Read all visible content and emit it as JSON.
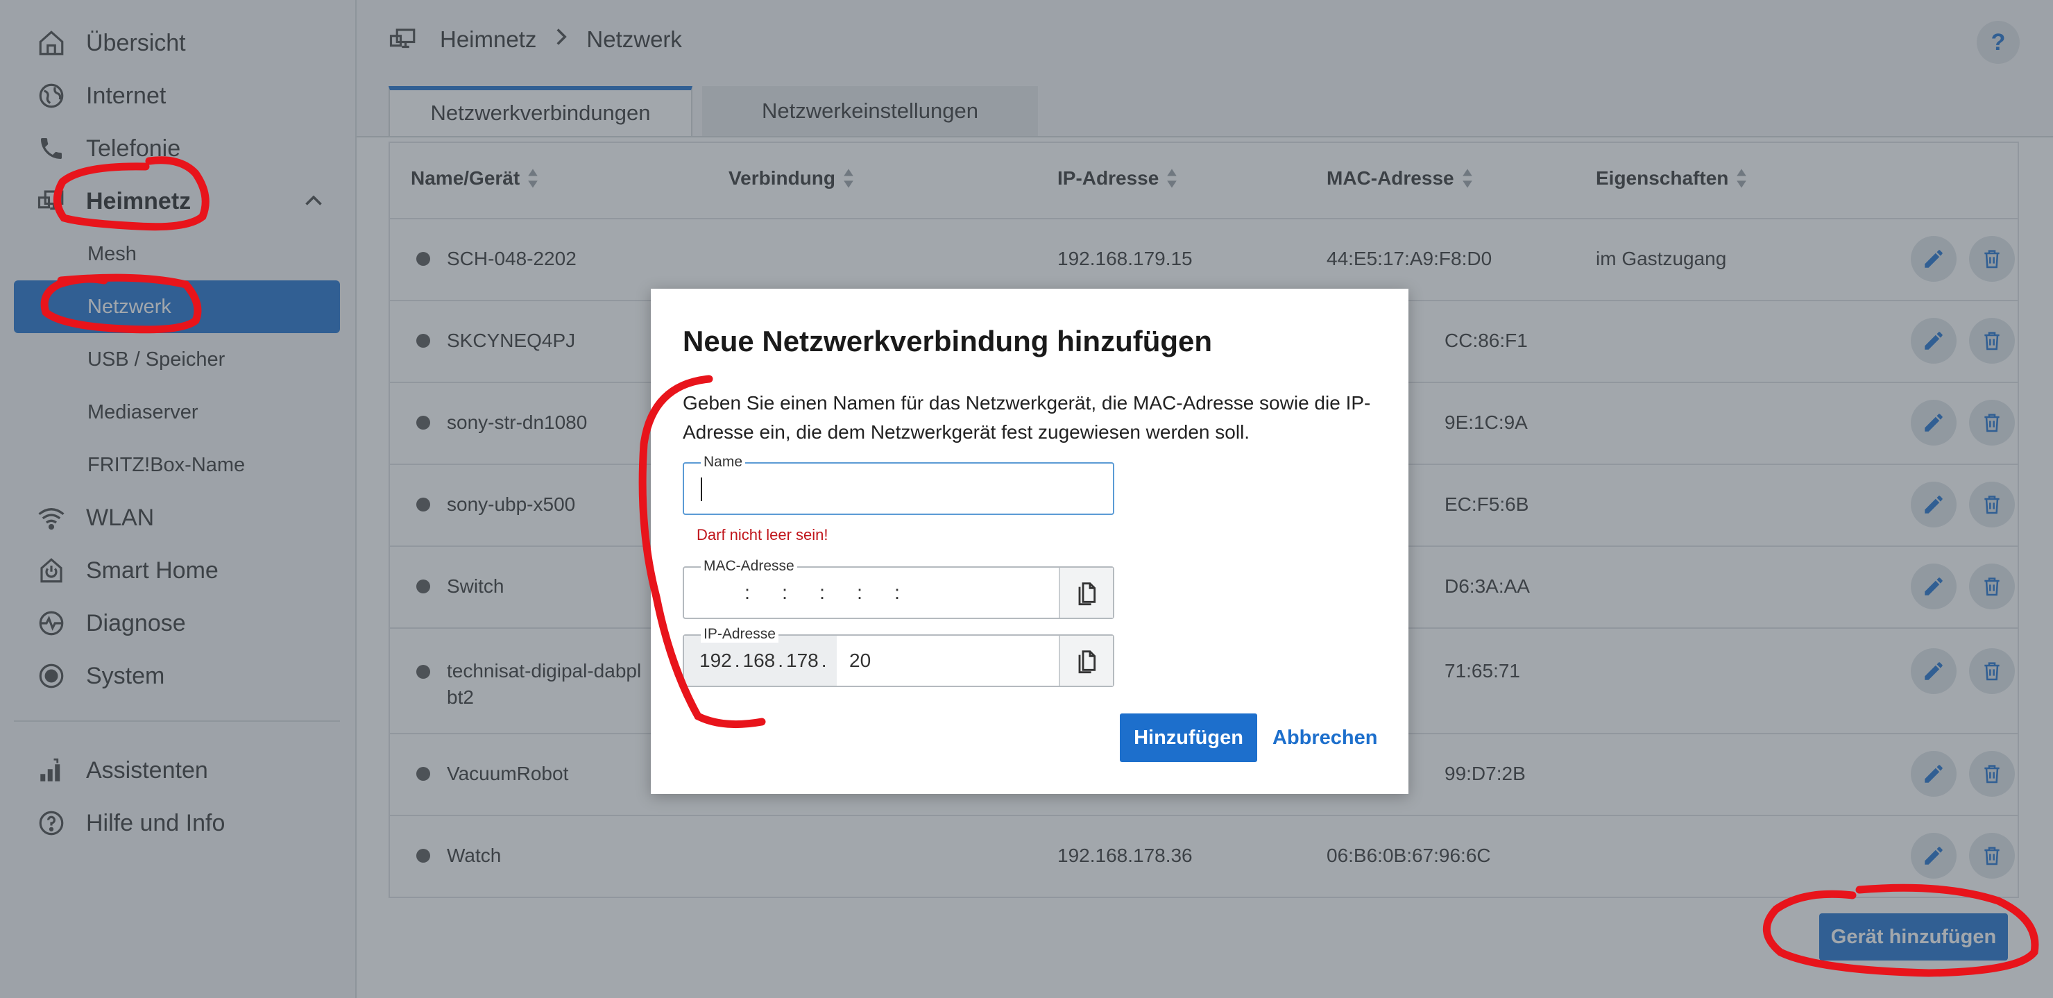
{
  "sidebar": {
    "items": [
      {
        "label": "Übersicht",
        "icon": "home-icon"
      },
      {
        "label": "Internet",
        "icon": "globe-icon"
      },
      {
        "label": "Telefonie",
        "icon": "phone-icon"
      },
      {
        "label": "Heimnetz",
        "icon": "network-icon",
        "expanded": true
      },
      {
        "label": "WLAN",
        "icon": "wifi-icon"
      },
      {
        "label": "Smart Home",
        "icon": "power-icon"
      },
      {
        "label": "Diagnose",
        "icon": "pulse-icon"
      },
      {
        "label": "System",
        "icon": "system-icon"
      },
      {
        "label": "Assistenten",
        "icon": "wizard-icon"
      },
      {
        "label": "Hilfe und Info",
        "icon": "help-circle-icon"
      }
    ],
    "sub_items": [
      {
        "label": "Mesh"
      },
      {
        "label": "Netzwerk",
        "active": true
      },
      {
        "label": "USB / Speicher"
      },
      {
        "label": "Mediaserver"
      },
      {
        "label": "FRITZ!Box-Name"
      }
    ]
  },
  "breadcrumb": {
    "first": "Heimnetz",
    "second": "Netzwerk"
  },
  "help_label": "?",
  "tabs": [
    {
      "label": "Netzwerkverbindungen",
      "active": true
    },
    {
      "label": "Netzwerkeinstellungen",
      "active": false
    }
  ],
  "table": {
    "headers": [
      "Name/Gerät",
      "Verbindung",
      "IP-Adresse",
      "MAC-Adresse",
      "Eigenschaften"
    ],
    "rows": [
      {
        "name": "SCH-048-2202",
        "ip": "192.168.179.15",
        "mac": "44:E5:17:A9:F8:D0",
        "props": "im Gastzugang"
      },
      {
        "name": "SKCYNEQ4PJ",
        "ip": "",
        "mac": "CC:86:F1",
        "props": ""
      },
      {
        "name": "sony-str-dn1080",
        "ip": "",
        "mac": "9E:1C:9A",
        "props": ""
      },
      {
        "name": "sony-ubp-x500",
        "ip": "",
        "mac": "EC:F5:6B",
        "props": ""
      },
      {
        "name": "Switch",
        "ip": "",
        "mac": "D6:3A:AA",
        "props": ""
      },
      {
        "name": "technisat-digipal-dabpl",
        "name2": "bt2",
        "ip": "",
        "mac": "71:65:71",
        "props": ""
      },
      {
        "name": "VacuumRobot",
        "ip": "",
        "mac": "99:D7:2B",
        "props": ""
      },
      {
        "name": "Watch",
        "ip": "192.168.178.36",
        "mac": "06:B6:0B:67:96:6C",
        "props": ""
      }
    ]
  },
  "add_device_label": "Gerät hinzufügen",
  "modal": {
    "title": "Neue Netzwerkverbindung hinzufügen",
    "description": "Geben Sie einen Namen für das Netzwerkgerät, die MAC-Adresse sowie die IP-Adresse ein, die dem Netzwerkgerät fest zugewiesen werden soll.",
    "name_legend": "Name",
    "name_value": "",
    "error": "Darf nicht leer sein!",
    "mac_legend": "MAC-Adresse",
    "mac_separators": [
      ":",
      ":",
      ":",
      ":",
      ":"
    ],
    "ip_legend": "IP-Adresse",
    "ip_fixed": [
      "192",
      "168",
      "178"
    ],
    "ip_dot": ".",
    "ip_last": "20",
    "submit_label": "Hinzufügen",
    "cancel_label": "Abbrechen"
  },
  "colors": {
    "accent": "#1d6fcc",
    "error": "#c0151b",
    "annotation": "#e8141b"
  }
}
